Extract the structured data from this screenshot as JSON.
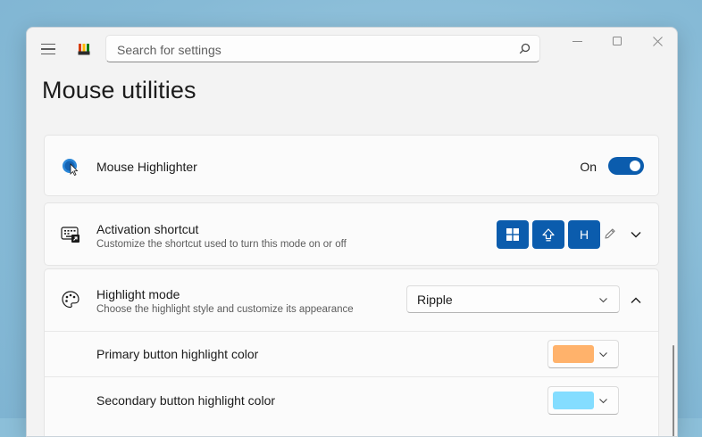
{
  "window": {
    "search_placeholder": "Search for settings"
  },
  "page": {
    "title": "Mouse utilities"
  },
  "highlighter": {
    "title": "Mouse Highlighter",
    "toggle_label": "On",
    "toggle_on": true
  },
  "activation": {
    "title": "Activation shortcut",
    "description": "Customize the shortcut used to turn this mode on or off",
    "keys": [
      "win-key",
      "shift-key",
      "H"
    ],
    "key_h": "H"
  },
  "highlight_mode": {
    "title": "Highlight mode",
    "description": "Choose the highlight style and customize its appearance",
    "selected": "Ripple"
  },
  "primary_color": {
    "label": "Primary button highlight color",
    "color": "#ffb26b"
  },
  "secondary_color": {
    "label": "Secondary button highlight color",
    "color": "#84ddff"
  },
  "colors": {
    "accent": "#0b5cad",
    "background": "#f3f3f3",
    "card": "#fbfbfb"
  }
}
